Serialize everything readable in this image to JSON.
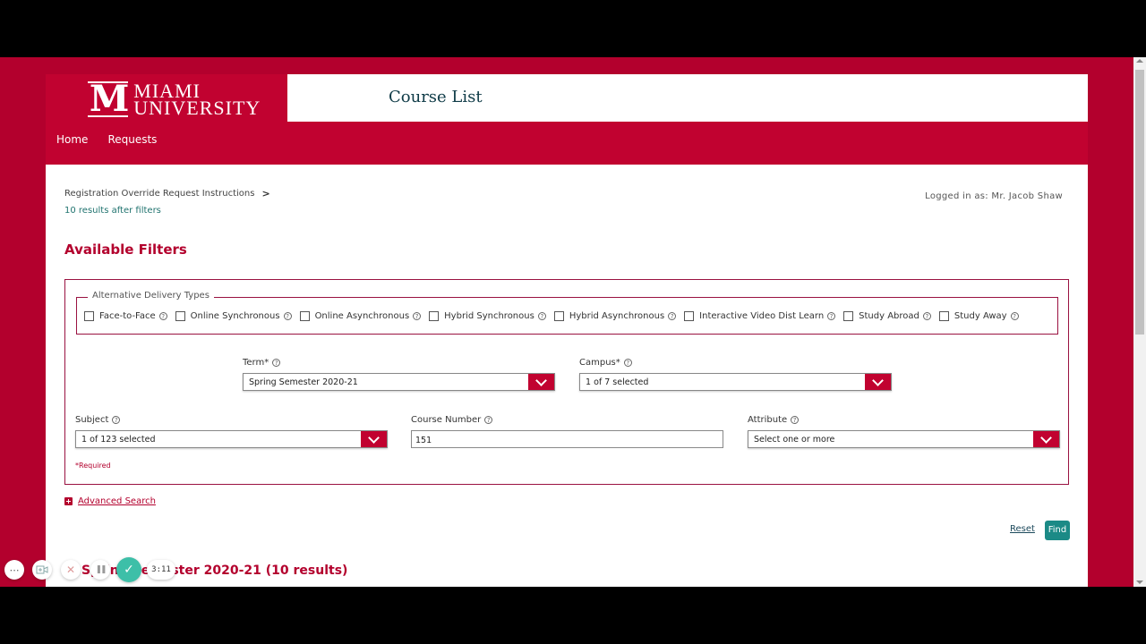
{
  "header": {
    "logo_mark": "M",
    "logo_line1": "MIAMI",
    "logo_line2": "UNIVERSITY",
    "page_title": "Course List",
    "nav": [
      {
        "label": "Home"
      },
      {
        "label": "Requests"
      }
    ]
  },
  "content": {
    "breadcrumb": "Registration Override Request Instructions",
    "results_count": "10 results after filters",
    "logged_in": "Logged in as: Mr. Jacob Shaw",
    "filters_heading": "Available Filters"
  },
  "filters": {
    "delivery_legend": "Alternative Delivery Types",
    "delivery_types": [
      {
        "label": "Face-to-Face",
        "checked": false
      },
      {
        "label": "Online Synchronous",
        "checked": false
      },
      {
        "label": "Online Asynchronous",
        "checked": false
      },
      {
        "label": "Hybrid Synchronous",
        "checked": false
      },
      {
        "label": "Hybrid Asynchronous",
        "checked": false
      },
      {
        "label": "Interactive Video Dist Learn",
        "checked": false
      },
      {
        "label": "Study Abroad",
        "checked": false
      },
      {
        "label": "Study Away",
        "checked": false
      }
    ],
    "help_glyph": "?",
    "term": {
      "label": "Term*",
      "value": "Spring Semester 2020-21"
    },
    "campus": {
      "label": "Campus*",
      "value": "1 of 7 selected"
    },
    "subject": {
      "label": "Subject",
      "value": "1 of 123 selected"
    },
    "course_number": {
      "label": "Course Number",
      "value": "151"
    },
    "attribute": {
      "label": "Attribute",
      "value": "Select one or more"
    },
    "required_note": "*Required"
  },
  "actions": {
    "advanced_search": "Advanced Search",
    "reset": "Reset",
    "find": "Find"
  },
  "results_heading": "Spring Semester 2020-21 (10 results)",
  "recorder": {
    "more": "⋯",
    "close": "✕",
    "pause": "❚❚",
    "done": "✓",
    "timer": "3:11"
  },
  "colors": {
    "brand_red": "#c10230",
    "accent_teal": "#1b8a86",
    "title_text": "#0f3b47"
  }
}
